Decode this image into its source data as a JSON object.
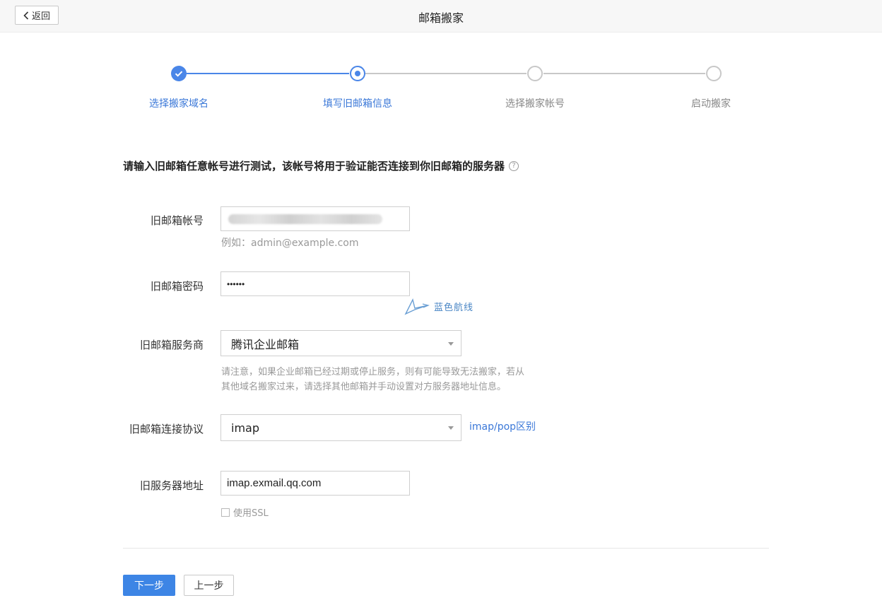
{
  "header": {
    "back_label": "返回",
    "title": "邮箱搬家"
  },
  "steps": [
    {
      "label": "选择搬家域名",
      "state": "done"
    },
    {
      "label": "填写旧邮箱信息",
      "state": "current"
    },
    {
      "label": "选择搬家帐号",
      "state": "todo"
    },
    {
      "label": "启动搬家",
      "state": "todo"
    }
  ],
  "intro": "请输入旧邮箱任意帐号进行测试，该帐号将用于验证能否连接到你旧邮箱的服务器",
  "form": {
    "account": {
      "label": "旧邮箱帐号",
      "hint": "例如：admin@example.com"
    },
    "password": {
      "label": "旧邮箱密码",
      "value": "••••••"
    },
    "provider": {
      "label": "旧邮箱服务商",
      "value": "腾讯企业邮箱",
      "note_line1": "请注意，如果企业邮箱已经过期或停止服务，则有可能导致无法搬家，若从",
      "note_line2": "其他域名搬家过来，请选择其他邮箱并手动设置对方服务器地址信息。"
    },
    "protocol": {
      "label": "旧邮箱连接协议",
      "value": "imap",
      "link": "imap/pop区别"
    },
    "server": {
      "label": "旧服务器地址",
      "value": "imap.exmail.qq.com",
      "ssl_label": "使用SSL"
    }
  },
  "watermark": {
    "text": "蓝色航线"
  },
  "buttons": {
    "next": "下一步",
    "prev": "上一步"
  },
  "colors": {
    "accent": "#3d85e5",
    "step_active": "#4a86e8",
    "step_inactive": "#c8c8c8"
  }
}
